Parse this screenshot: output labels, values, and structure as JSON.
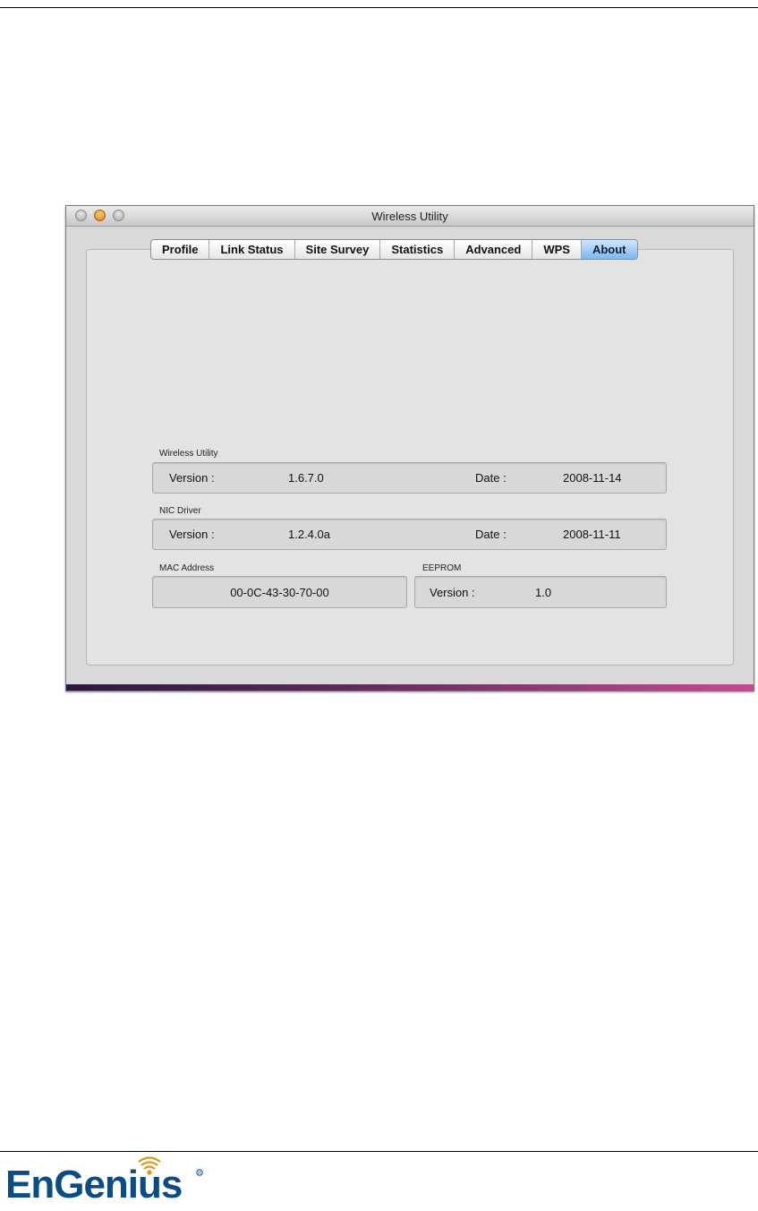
{
  "window": {
    "title": "Wireless Utility"
  },
  "tabs": [
    {
      "label": "Profile"
    },
    {
      "label": "Link Status"
    },
    {
      "label": "Site Survey"
    },
    {
      "label": "Statistics"
    },
    {
      "label": "Advanced"
    },
    {
      "label": "WPS"
    },
    {
      "label": "About",
      "active": true
    }
  ],
  "wireless_utility": {
    "group_label": "Wireless Utility",
    "version_label": "Version :",
    "version_value": "1.6.7.0",
    "date_label": "Date :",
    "date_value": "2008-11-14"
  },
  "nic_driver": {
    "group_label": "NIC Driver",
    "version_label": "Version :",
    "version_value": "1.2.4.0a",
    "date_label": "Date :",
    "date_value": "2008-11-11"
  },
  "mac_address": {
    "group_label": "MAC Address",
    "value": "00-0C-43-30-70-00"
  },
  "eeprom": {
    "group_label": "EEPROM",
    "version_label": "Version :",
    "version_value": "1.0"
  },
  "logo": {
    "text": "EnGenius"
  },
  "colors": {
    "active_tab": "#7eb6ee",
    "minimize_button": "#e5751c",
    "brand": "#0a4c84"
  }
}
